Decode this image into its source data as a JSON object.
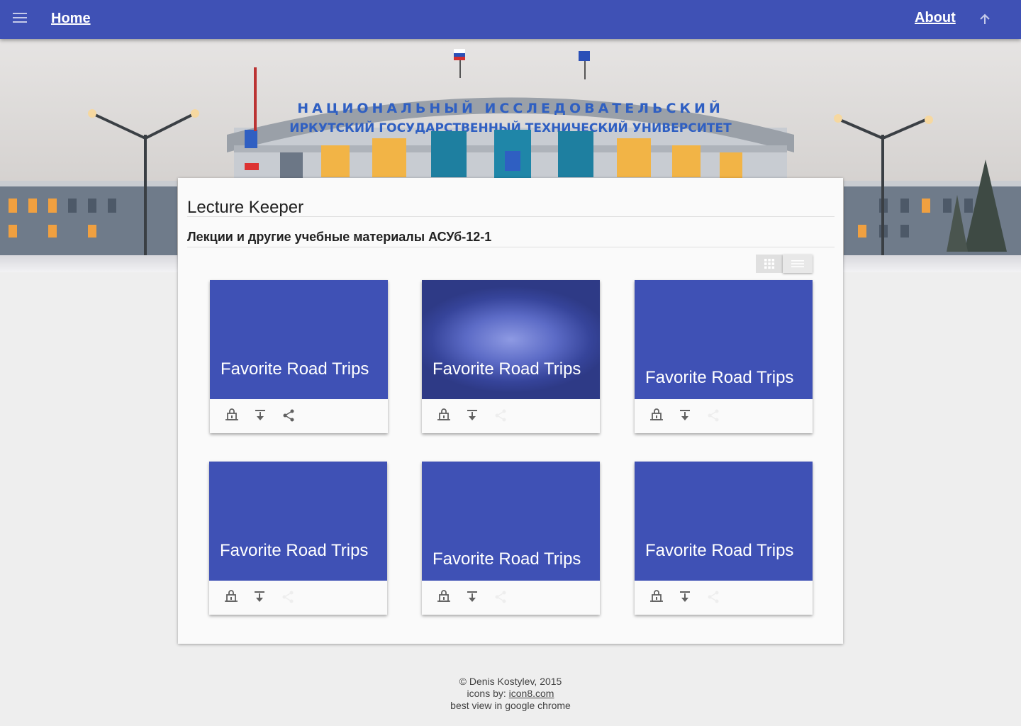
{
  "nav": {
    "home_label": "Home",
    "about_label": "About",
    "menu_icon": "menu-icon",
    "up_icon": "arrow-up-icon"
  },
  "hero": {
    "image": "university-building-photo",
    "sign_line1": "НАЦИОНАЛЬНЫЙ ИССЛЕДОВАТЕЛЬСКИЙ",
    "sign_line2": "ИРКУТСКИЙ ГОСУДАРСТВЕННЫЙ ТЕХНИЧЕСКИЙ УНИВЕРСИТЕТ"
  },
  "main": {
    "title": "Lecture Keeper",
    "subtitle": "Лекции и другие учебные материалы АСУб-12-1",
    "view_toggle": {
      "grid_icon": "grid-view-icon",
      "list_icon": "list-view-icon"
    }
  },
  "tiles": [
    {
      "title": "Favorite Road Trips"
    },
    {
      "title": "Favorite Road Trips"
    },
    {
      "title": "Favorite Road Trips"
    },
    {
      "title": "Favorite Road Trips"
    },
    {
      "title": "Favorite Road Trips"
    },
    {
      "title": "Favorite Road Trips"
    }
  ],
  "tile_action_icons": [
    "laptop-lock-icon",
    "download-icon",
    "share-icon"
  ],
  "footer": {
    "copyright": "© Denis Kostylev, 2015",
    "icons_prefix": "icons by: ",
    "icons_link": "icon8.com",
    "browser_note": "best view in google chrome"
  },
  "colors": {
    "primary": "#3f51b5",
    "background": "#eeeeee",
    "card": "#fafafa"
  }
}
